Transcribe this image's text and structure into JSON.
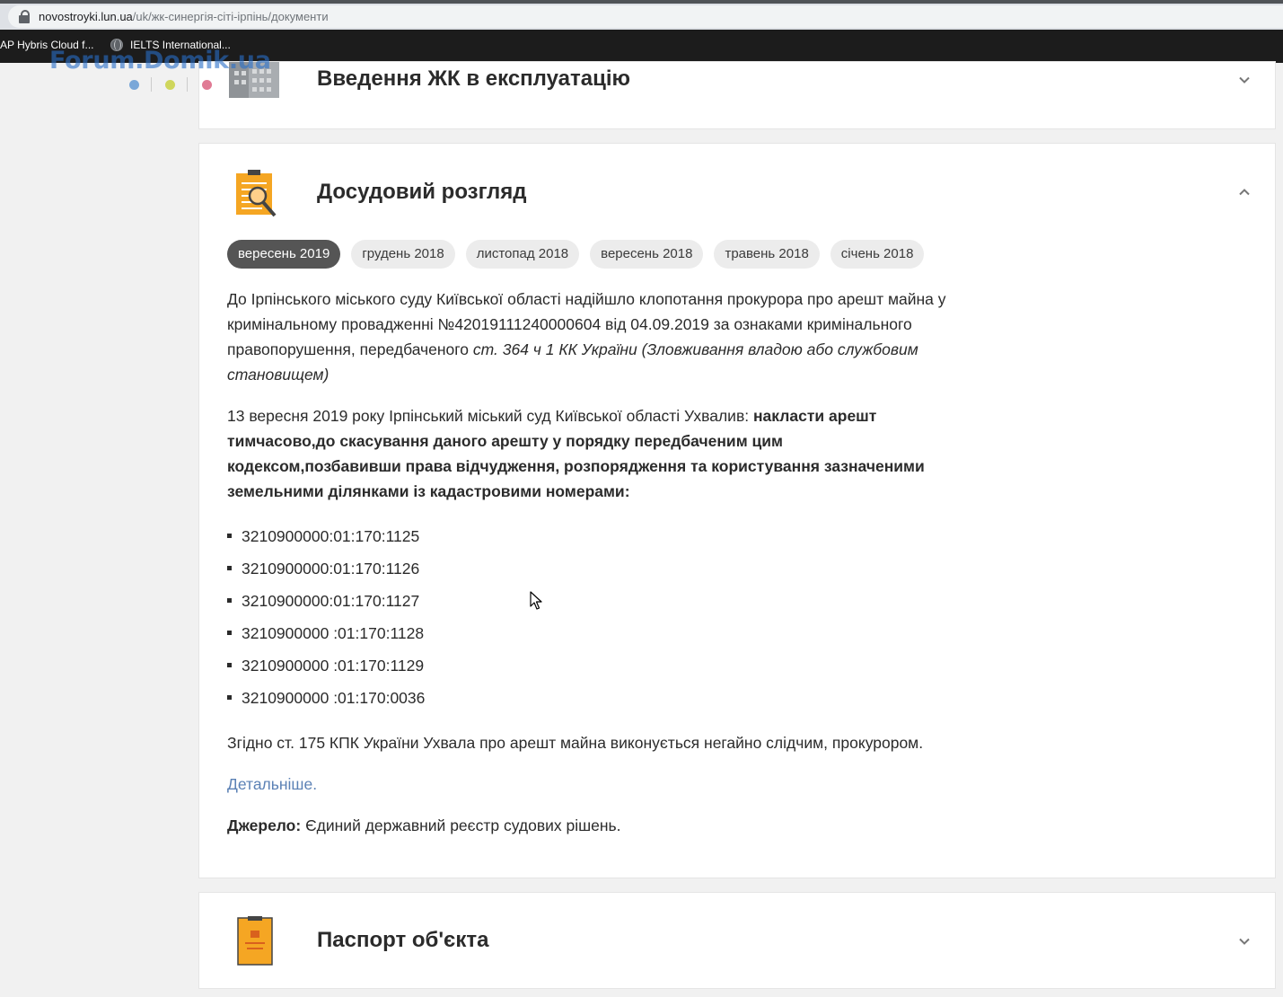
{
  "browser": {
    "url_host": "novostroyki.lun.ua",
    "url_path": "/uk/жк-синергія-сіті-ірпінь/документи",
    "bookmarks": [
      "AP Hybris Cloud f...",
      "IELTS International..."
    ]
  },
  "watermark": {
    "text": "Forum.Domik.ua",
    "dot_colors": [
      "#7aa7d8",
      "#cfd65c",
      "#e07a94"
    ]
  },
  "sections": {
    "commissioning": {
      "title": "Введення ЖК в експлуатацію"
    },
    "pretrial": {
      "title": "Досудовий розгляд",
      "chips": [
        "вересень 2019",
        "грудень 2018",
        "листопад 2018",
        "вересень 2018",
        "травень 2018",
        "січень 2018"
      ],
      "active_chip": "вересень 2019",
      "p1_text": "До Ірпінського міського суду Київської області надійшло клопотання прокурора про арешт майна у кримінальному провадженні №42019111240000604 від 04.09.2019 за ознаками кримінального правопорушення, передбаченого ",
      "p1_italic": "ст. 364 ч 1 КК України (Зловживання владою або службовим становищем)",
      "p2_text": "13 вересня 2019 року Ірпінський міський суд Київської області Ухвалив: ",
      "p2_bold": "накласти арешт тимчасово,до скасування даного арешту у порядку передбаченим цим кодексом,позбавивши права відчудження, розпорядження та користування зазначеними земельними ділянками із кадастровими номерами:",
      "cadastral": [
        "3210900000:01:170:1125",
        "3210900000:01:170:1126",
        "3210900000:01:170:1127",
        "3210900000 :01:170:1128",
        "3210900000 :01:170:1129",
        "3210900000 :01:170:0036"
      ],
      "p3_text": "Згідно ст. 175 КПК України Ухвала про арешт майна виконується негайно слідчим, прокурором.",
      "more_link": "Детальніше.",
      "source_label": "Джерело:",
      "source_text": " Єдиний державний реєстр судових рішень."
    },
    "passport": {
      "title": "Паспорт об'єкта"
    }
  },
  "colors": {
    "icon_orange": "#f5a623",
    "chip_active": "#555555",
    "link": "#5b81b5"
  }
}
